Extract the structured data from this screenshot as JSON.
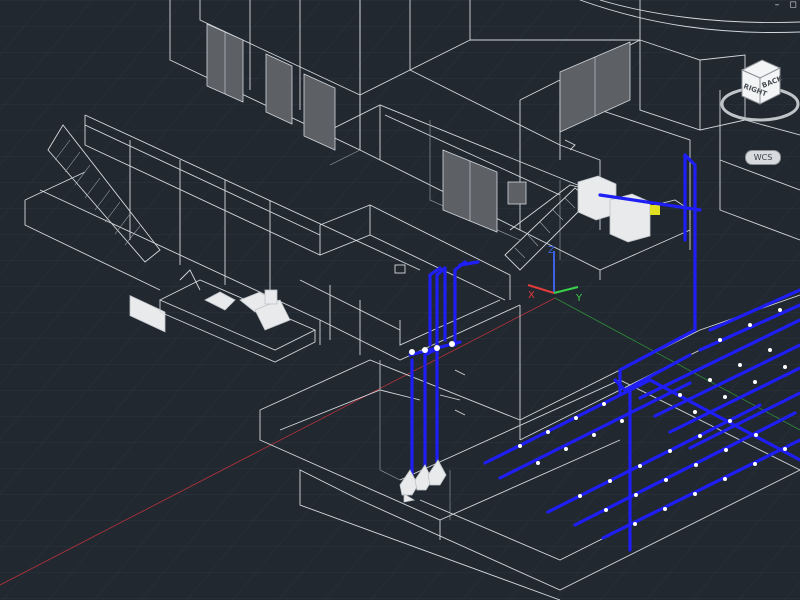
{
  "app": {
    "title": "",
    "background_color": "#212830",
    "grid_color": "#2c3540",
    "pipe_color": "#1e1ef5"
  },
  "viewcube": {
    "face_right": "RIGHT",
    "face_back": "BACK",
    "icon": "viewcube-icon"
  },
  "wcs": {
    "label": "WCS"
  },
  "ucs": {
    "x_label": "X",
    "y_label": "Y",
    "z_label": "Z",
    "x_color": "#e23b3b",
    "y_color": "#3bd14a",
    "z_color": "#3b62e2"
  },
  "window_controls": {
    "minimize_icon": "minimize-icon",
    "restore_icon": "restore-icon",
    "restore_glyph": "◻",
    "minimize_glyph": "–"
  }
}
